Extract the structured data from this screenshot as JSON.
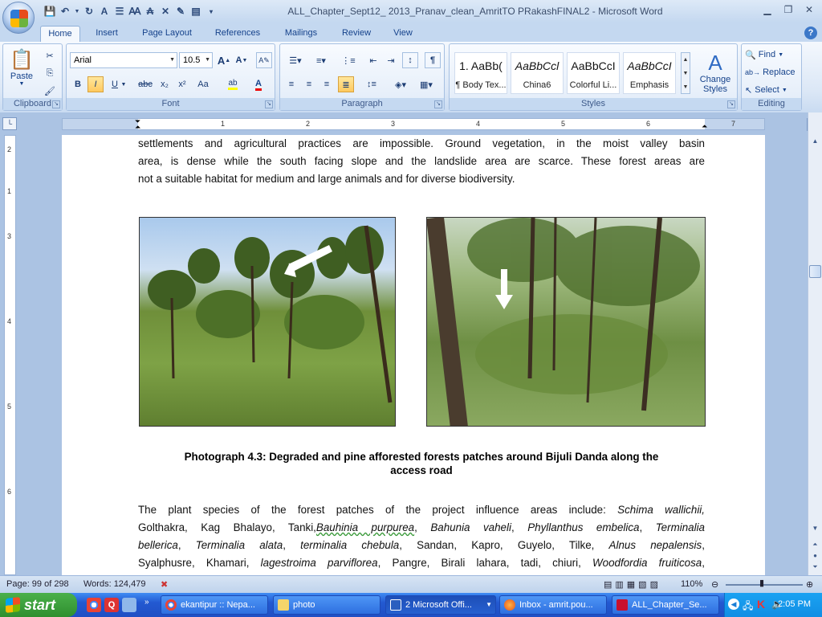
{
  "window": {
    "title": "ALL_Chapter_Sept12_ 2013_Pranav_clean_AmritTO PRakashFINAL2 - Microsoft Word",
    "controls": [
      "minimize-icon",
      "restore-icon",
      "close-icon"
    ]
  },
  "quick_access": [
    "save-icon",
    "undo-icon",
    "redo-icon",
    "font-icon",
    "bullets-icon",
    "change-case-icon",
    "strike-icon",
    "clear-format-icon",
    "track-icon",
    "more-icon"
  ],
  "tabs": [
    "Home",
    "Insert",
    "Page Layout",
    "References",
    "Mailings",
    "Review",
    "View"
  ],
  "active_tab": "Home",
  "ribbon": {
    "clipboard": {
      "title": "Clipboard",
      "paste": "Paste"
    },
    "font": {
      "title": "Font",
      "family": "Arial",
      "size": "10.5",
      "buttons": [
        "B",
        "I",
        "U",
        "abc",
        "x₂",
        "x²",
        "Aa"
      ]
    },
    "paragraph": {
      "title": "Paragraph"
    },
    "styles": {
      "title": "Styles",
      "items": [
        {
          "sample": "1.  AaBb(",
          "name": "¶ Body Tex..."
        },
        {
          "sample": "AaBbCcl",
          "name": "China6"
        },
        {
          "sample": "AaBbCcI",
          "name": "Colorful Li..."
        },
        {
          "sample": "AaBbCcI",
          "name": "Emphasis"
        }
      ],
      "change_styles": "Change Styles"
    },
    "editing": {
      "title": "Editing",
      "find": "Find",
      "replace": "Replace",
      "select": "Select"
    }
  },
  "ruler": {
    "numbers": [
      "1",
      "2",
      "3",
      "4",
      "5",
      "6",
      "7"
    ],
    "vnumbers": [
      "2",
      "1",
      "3",
      "4",
      "5",
      "6"
    ]
  },
  "document": {
    "para1": [
      "settlements and agricultural practices are impossible. Ground vegetation, in the moist valley basin",
      "area, is dense while the south facing slope and the landslide area are scarce. These forest areas are",
      "not a suitable habitat for medium and large animals and for diverse biodiversity."
    ],
    "caption_line1": "Photograph 4.3: Degraded and pine afforested forests patches around Bijuli Danda along the",
    "caption_line2": "access road",
    "para2_l1_a": "The plant species of the forest patches of the project influence areas include:",
    "para2_l1_b": "Schima wallichii,",
    "para2_l2_a": "Golthakra, Kag Bhalayo, Tanki,",
    "para2_l2_b": "Bauhinia purpurea",
    "para2_l2_c": ", ",
    "para2_l2_d": "Bahunia vaheli",
    "para2_l2_e": ", ",
    "para2_l2_f": "Phyllanthus embelica",
    "para2_l2_g": ", ",
    "para2_l2_h": "Terminalia",
    "para2_l3_a": "bellerica",
    "para2_l3_b": ", ",
    "para2_l3_c": "Terminalia alata",
    "para2_l3_d": ", ",
    "para2_l3_e": "terminalia chebula",
    "para2_l3_f": ", Sandan, Kapro, Guyelo, Tilke, ",
    "para2_l3_g": "Alnus nepalensis",
    "para2_l3_h": ",",
    "para2_l4_a": "Syalphusre, Khamari, ",
    "para2_l4_b": "lagestroima parviflorea",
    "para2_l4_c": ", Pangre, Birali lahara, tadi, chiuri, ",
    "para2_l4_d": "Woodfordia fruiticosa",
    "para2_l4_e": ","
  },
  "status": {
    "page": "Page: 99 of 298",
    "words": "Words: 124,479",
    "zoom": "110%"
  },
  "taskbar": {
    "start": "start",
    "items": [
      {
        "label": "ekantipur :: Nepa...",
        "icon": "chrome-icon"
      },
      {
        "label": "photo",
        "icon": "folder-icon"
      },
      {
        "label": "2 Microsoft Offi...",
        "icon": "word-icon"
      },
      {
        "label": "Inbox - amrit.pou...",
        "icon": "firefox-icon"
      },
      {
        "label": "ALL_Chapter_Se...",
        "icon": "pdf-icon"
      }
    ],
    "clock": "2:05 PM"
  },
  "colors": {
    "ribbon": "#dbe7f6",
    "accent": "#15428b",
    "taskbar": "#245edb"
  }
}
